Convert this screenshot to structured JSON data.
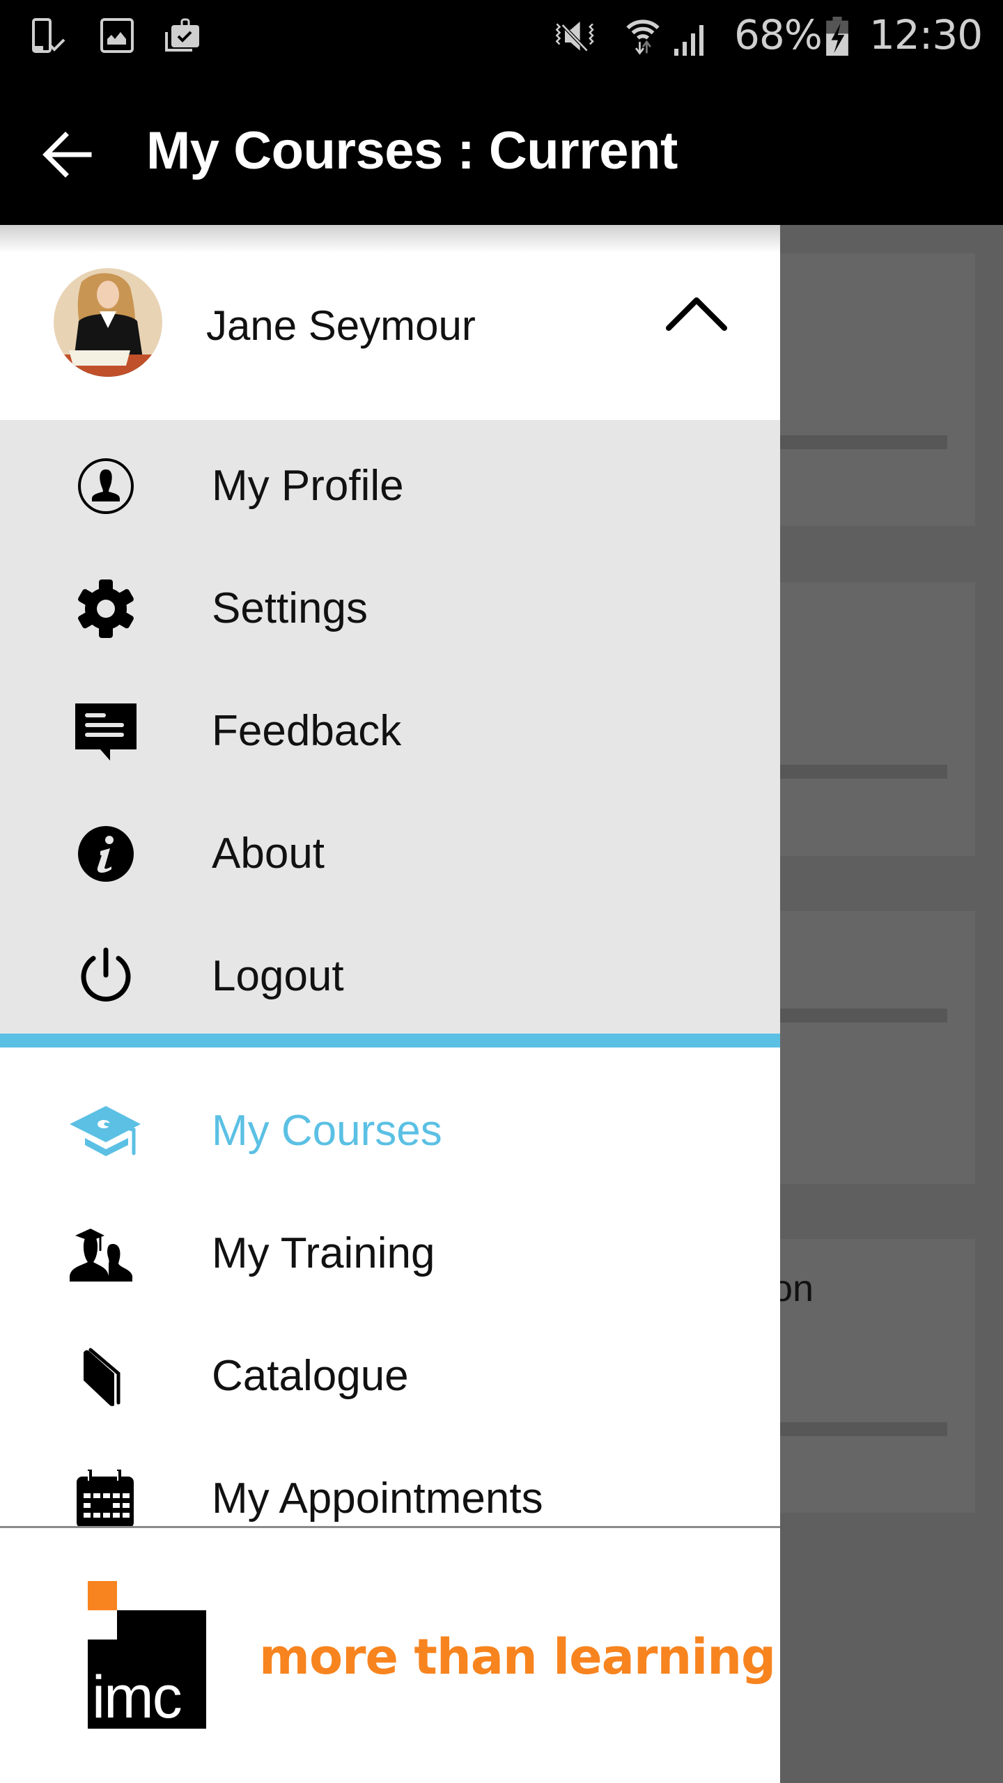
{
  "status_bar": {
    "left_icons": [
      "phone-check-icon",
      "image-icon",
      "briefcase-check-icon"
    ],
    "right_icons": [
      "vibrate-mute-icon",
      "wifi-icon",
      "signal-icon",
      "battery-charging-icon"
    ],
    "battery_percent": "68%",
    "time": "12:30"
  },
  "toolbar": {
    "back_icon": "arrow-left-icon",
    "title": "My Courses : Current"
  },
  "drawer": {
    "account": {
      "name": "Jane Seymour",
      "toggle_icon": "chevron-up-icon"
    },
    "account_menu": [
      {
        "label": "My Profile",
        "icon": "account-circle-icon"
      },
      {
        "label": "Settings",
        "icon": "gear-icon"
      },
      {
        "label": "Feedback",
        "icon": "feedback-icon"
      },
      {
        "label": "About",
        "icon": "info-icon"
      },
      {
        "label": "Logout",
        "icon": "power-icon"
      }
    ],
    "nav_menu": [
      {
        "label": "My Courses",
        "icon": "graduation-cap-icon",
        "active": true
      },
      {
        "label": "My Training",
        "icon": "training-group-icon",
        "active": false
      },
      {
        "label": "Catalogue",
        "icon": "book-icon",
        "active": false
      },
      {
        "label": "My Appointments",
        "icon": "calendar-icon",
        "active": false
      }
    ],
    "footer": {
      "logo_text": "imc",
      "tagline": "more than learning"
    }
  },
  "background": {
    "visible_text_fragment": "on"
  },
  "colors": {
    "accent": "#5bc0e4",
    "brand_orange": "#f7841f",
    "menu_bg": "#e6e6e6",
    "scrim": "#5f5f5f"
  }
}
